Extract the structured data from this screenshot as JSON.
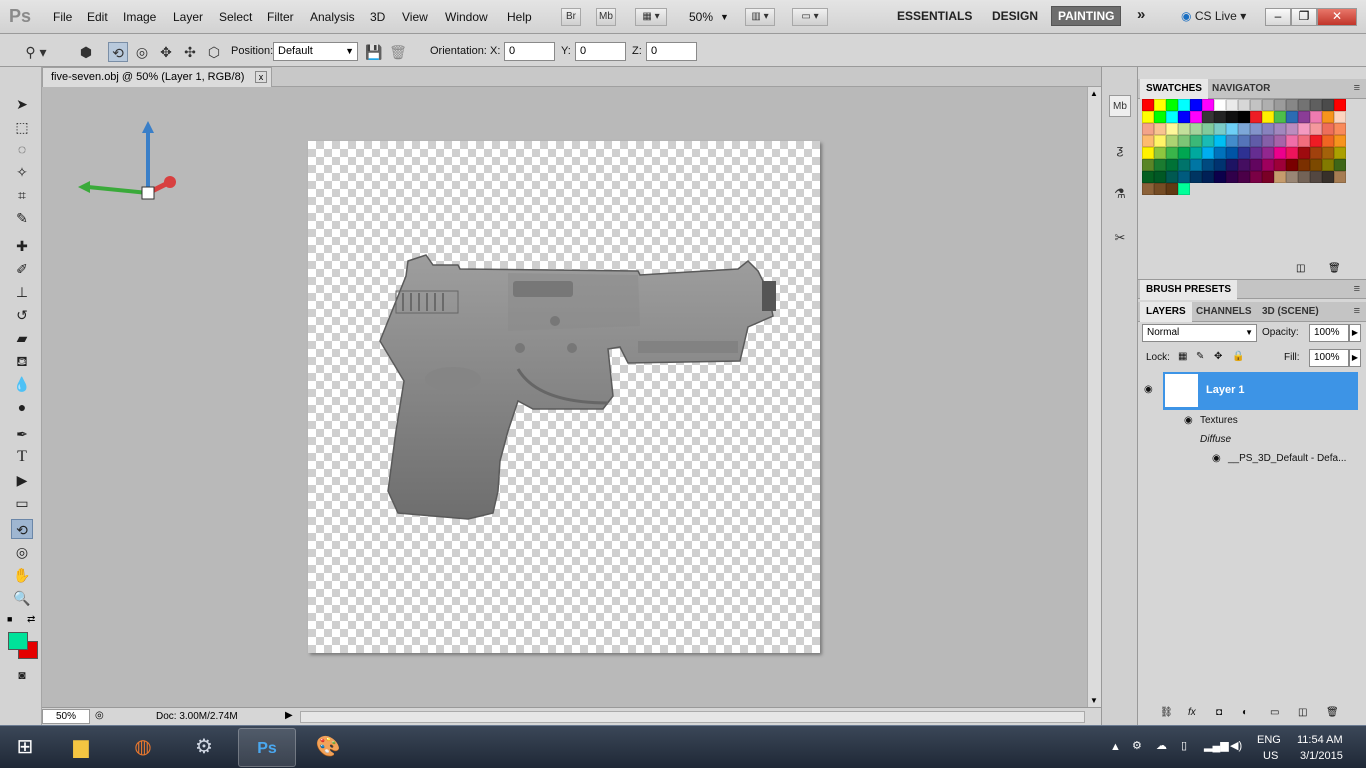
{
  "app": {
    "logo": "Ps"
  },
  "menu": [
    "File",
    "Edit",
    "Image",
    "Layer",
    "Select",
    "Filter",
    "Analysis",
    "3D",
    "View",
    "Window",
    "Help"
  ],
  "toolbar_buttons": {
    "bridge": "Br",
    "mini_bridge": "Mb",
    "zoom": "50%"
  },
  "workspaces": {
    "essentials": "ESSENTIALS",
    "design": "DESIGN",
    "painting": "PAINTING",
    "more": "»",
    "cs_live": "CS Live"
  },
  "window_controls": {
    "minimize": "–",
    "restore": "❐",
    "close": "✕"
  },
  "options": {
    "position_label": "Position:",
    "position_value": "Default",
    "orientation_label": "Orientation:",
    "x_label": "X:",
    "x_value": "0",
    "y_label": "Y:",
    "y_value": "0",
    "z_label": "Z:",
    "z_value": "0"
  },
  "document": {
    "tab_title": "five-seven.obj @ 50% (Layer 1, RGB/8)",
    "close": "x"
  },
  "status": {
    "zoom": "50%",
    "doc_size": "Doc: 3.00M/2.74M"
  },
  "strip_icons": [
    "Mb",
    "brush-icon",
    "wrench-icon",
    "tools-icon"
  ],
  "panels": {
    "swatches_tab": "SWATCHES",
    "navigator_tab": "NAVIGATOR",
    "brush_presets_tab": "BRUSH PRESETS",
    "layers_tab": "LAYERS",
    "channels_tab": "CHANNELS",
    "scene_tab": "3D (SCENE)"
  },
  "swatch_colors": [
    "#ff0000",
    "#ffff00",
    "#00ff00",
    "#00ffff",
    "#0000ff",
    "#ff00ff",
    "#ffffff",
    "#ebebeb",
    "#d7d7d7",
    "#c3c3c3",
    "#afafaf",
    "#9b9b9b",
    "#878787",
    "#737373",
    "#5f5f5f",
    "#4b4b4b",
    "#ff0000",
    "#ffff00",
    "#00ff00",
    "#00ffff",
    "#0000ff",
    "#ff00ff",
    "#373737",
    "#232323",
    "#0f0f0f",
    "#000000",
    "#ee1d24",
    "#ffef00",
    "#4dbf4b",
    "#2b6cb3",
    "#8a3d96",
    "#ee7bb0",
    "#f7941d",
    "#fcd4c0",
    "#f3a38a",
    "#f8c490",
    "#fff79a",
    "#c4df9b",
    "#a3d39c",
    "#82ca9c",
    "#7accc8",
    "#6dcff6",
    "#7da7d8",
    "#8393ca",
    "#8882be",
    "#a187be",
    "#bc8cbf",
    "#f49ac1",
    "#f5989d",
    "#ee6e5a",
    "#f98a5b",
    "#fdbb6f",
    "#fff467",
    "#acd372",
    "#7cc576",
    "#3bb878",
    "#1abbb4",
    "#00bff3",
    "#438ccb",
    "#5574b9",
    "#605ca8",
    "#855fa8",
    "#a763a9",
    "#ef6ea8",
    "#f16d7e",
    "#ee1c24",
    "#f16522",
    "#f7941d",
    "#fff200",
    "#8dc63f",
    "#39b54a",
    "#00a651",
    "#00a99e",
    "#00aeef",
    "#0072bc",
    "#0054a5",
    "#2e3192",
    "#652d91",
    "#92278f",
    "#ec008c",
    "#ed145b",
    "#9e0b0f",
    "#a0410d",
    "#a3620a",
    "#aba000",
    "#598527",
    "#1a7b30",
    "#007236",
    "#00746b",
    "#0076a4",
    "#004a80",
    "#003370",
    "#1d1363",
    "#450e61",
    "#62055f",
    "#9e005d",
    "#9d0039",
    "#790000",
    "#7b3000",
    "#7c4900",
    "#827a00",
    "#3e6617",
    "#045f20",
    "#005824",
    "#005951",
    "#005b7e",
    "#003562",
    "#002056",
    "#0c004b",
    "#30004a",
    "#4b0048",
    "#7a0045",
    "#7a0026",
    "#c69c6d",
    "#998675",
    "#736357",
    "#534741",
    "#37302a",
    "#a67c52",
    "#8c6239",
    "#754c24",
    "#603913",
    "#00ff99"
  ],
  "layers": {
    "blend_mode": "Normal",
    "opacity_label": "Opacity:",
    "opacity_value": "100%",
    "lock_label": "Lock:",
    "fill_label": "Fill:",
    "fill_value": "100%",
    "layer_name": "Layer 1",
    "textures_label": "Textures",
    "diffuse_label": "Diffuse",
    "texture_file": "__PS_3D_Default - Defa..."
  },
  "taskbar": {
    "lang": "ENG",
    "region": "US",
    "time": "11:54 AM",
    "date": "3/1/2015"
  },
  "colors": {
    "foreground": "#00e29a",
    "background": "#e40000",
    "layer_highlight": "#3d94e6"
  }
}
